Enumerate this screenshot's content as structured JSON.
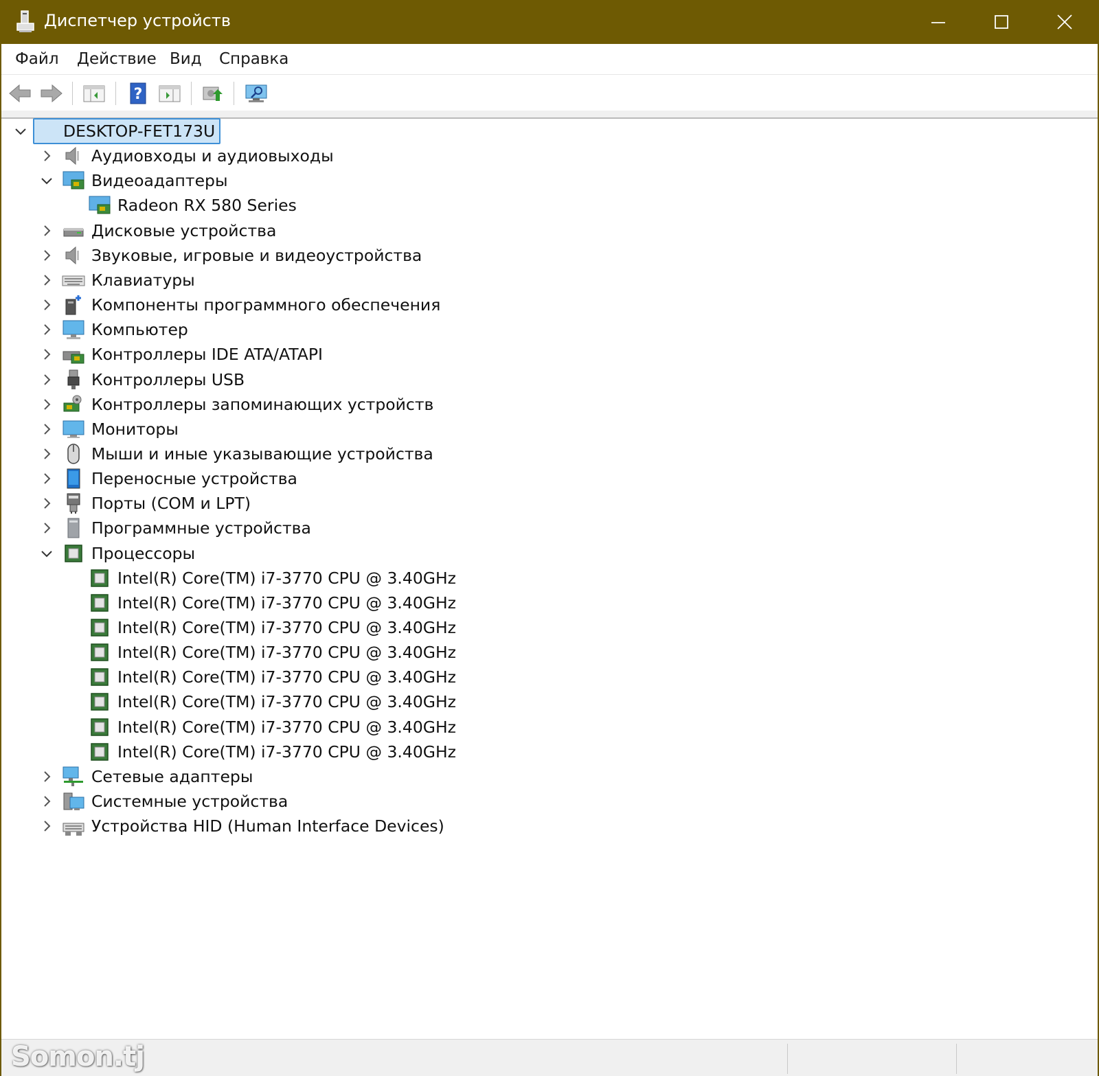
{
  "window": {
    "title": "Диспетчер устройств",
    "accent_color": "#6e5a03"
  },
  "menu": [
    {
      "label": "Файл"
    },
    {
      "label": "Действие"
    },
    {
      "label": "Вид"
    },
    {
      "label": "Справка"
    }
  ],
  "toolbar": {
    "buttons": [
      "back-arrow-icon",
      "forward-arrow-icon",
      "show-hide-console-tree-icon",
      "help-icon",
      "properties-icon",
      "update-driver-icon",
      "scan-hardware-icon"
    ]
  },
  "tree": {
    "root": {
      "label": "DESKTOP-FET173U",
      "expanded": true,
      "selected": true
    },
    "categories": [
      {
        "label": "Аудиовходы и аудиовыходы",
        "icon": "audio-icon",
        "expanded": false
      },
      {
        "label": "Видеоадаптеры",
        "icon": "display-adapter-icon",
        "expanded": true
      },
      {
        "label": "Radeon RX 580 Series",
        "icon": "display-adapter-icon",
        "child": true
      },
      {
        "label": "Дисковые устройства",
        "icon": "disk-drive-icon",
        "expanded": false
      },
      {
        "label": "Звуковые, игровые и видеоустройства",
        "icon": "audio-icon",
        "expanded": false
      },
      {
        "label": "Клавиатуры",
        "icon": "keyboard-icon",
        "expanded": false
      },
      {
        "label": "Компоненты программного обеспечения",
        "icon": "software-component-icon",
        "expanded": false
      },
      {
        "label": "Компьютер",
        "icon": "computer-icon",
        "expanded": false
      },
      {
        "label": "Контроллеры IDE ATA/ATAPI",
        "icon": "ide-controller-icon",
        "expanded": false
      },
      {
        "label": "Контроллеры USB",
        "icon": "usb-icon",
        "expanded": false
      },
      {
        "label": "Контроллеры запоминающих устройств",
        "icon": "storage-controller-icon",
        "expanded": false
      },
      {
        "label": "Мониторы",
        "icon": "monitor-icon",
        "expanded": false
      },
      {
        "label": "Мыши и иные указывающие устройства",
        "icon": "mouse-icon",
        "expanded": false
      },
      {
        "label": "Переносные устройства",
        "icon": "portable-device-icon",
        "expanded": false
      },
      {
        "label": "Порты (COM и LPT)",
        "icon": "port-icon",
        "expanded": false
      },
      {
        "label": "Программные устройства",
        "icon": "software-device-icon",
        "expanded": false
      },
      {
        "label": "Процессоры",
        "icon": "processor-icon",
        "expanded": true
      },
      {
        "label": "Intel(R) Core(TM) i7-3770 CPU @ 3.40GHz",
        "icon": "processor-icon",
        "child": true
      },
      {
        "label": "Intel(R) Core(TM) i7-3770 CPU @ 3.40GHz",
        "icon": "processor-icon",
        "child": true
      },
      {
        "label": "Intel(R) Core(TM) i7-3770 CPU @ 3.40GHz",
        "icon": "processor-icon",
        "child": true
      },
      {
        "label": "Intel(R) Core(TM) i7-3770 CPU @ 3.40GHz",
        "icon": "processor-icon",
        "child": true
      },
      {
        "label": "Intel(R) Core(TM) i7-3770 CPU @ 3.40GHz",
        "icon": "processor-icon",
        "child": true
      },
      {
        "label": "Intel(R) Core(TM) i7-3770 CPU @ 3.40GHz",
        "icon": "processor-icon",
        "child": true
      },
      {
        "label": "Intel(R) Core(TM) i7-3770 CPU @ 3.40GHz",
        "icon": "processor-icon",
        "child": true
      },
      {
        "label": "Intel(R) Core(TM) i7-3770 CPU @ 3.40GHz",
        "icon": "processor-icon",
        "child": true
      },
      {
        "label": "Сетевые адаптеры",
        "icon": "network-adapter-icon",
        "expanded": false
      },
      {
        "label": "Системные устройства",
        "icon": "system-device-icon",
        "expanded": false
      },
      {
        "label": "Устройства HID (Human Interface Devices)",
        "icon": "hid-icon",
        "expanded": false
      }
    ]
  },
  "watermark": "Somon.tj"
}
